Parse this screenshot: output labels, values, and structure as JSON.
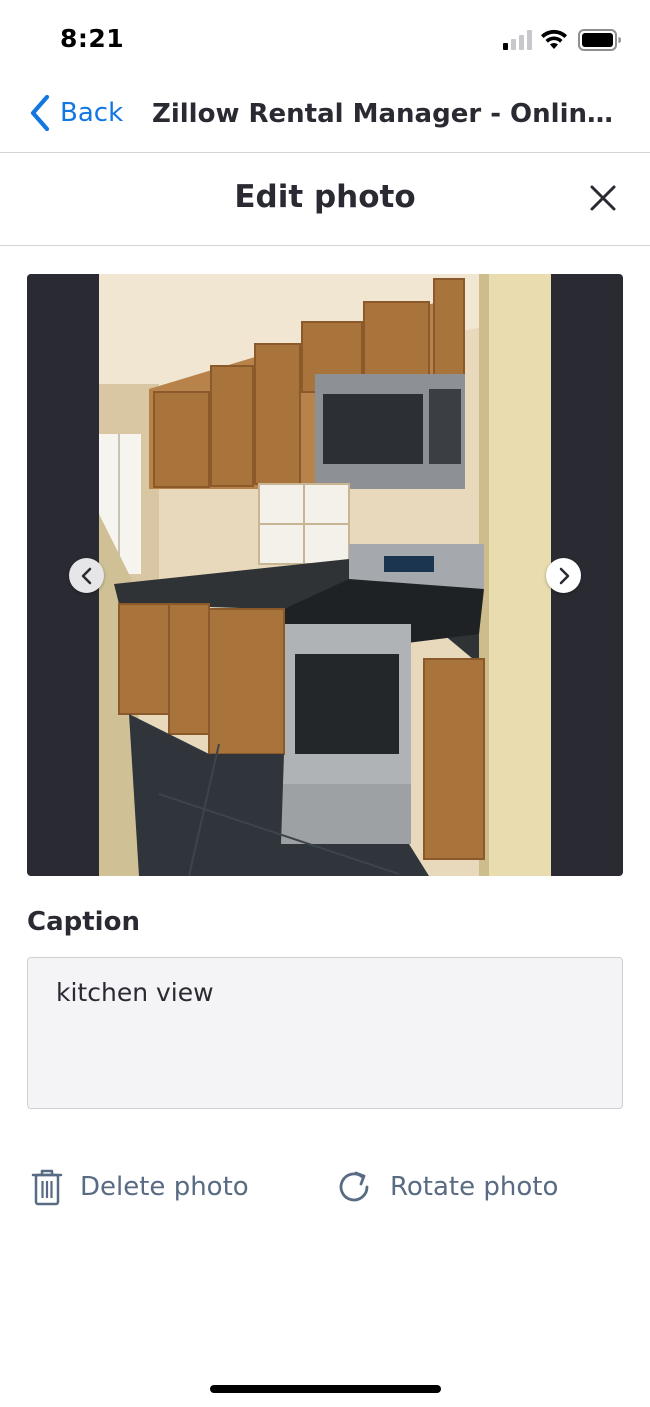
{
  "status_bar": {
    "time": "8:21"
  },
  "nav": {
    "back_label": "Back",
    "title": "Zillow Rental Manager - Online Pr..."
  },
  "modal": {
    "title": "Edit photo"
  },
  "photo": {
    "subject": "kitchen"
  },
  "caption": {
    "label": "Caption",
    "value": "kitchen view"
  },
  "actions": {
    "delete_label": "Delete photo",
    "rotate_label": "Rotate photo"
  },
  "colors": {
    "accent": "#1277e1",
    "text": "#2a2a33",
    "muted": "#596b82",
    "frame": "#2a2a33"
  },
  "icons": [
    "back-chevron-icon",
    "close-icon",
    "chevron-left-icon",
    "chevron-right-icon",
    "trash-icon",
    "rotate-icon",
    "signal-icon",
    "wifi-icon",
    "battery-icon"
  ]
}
